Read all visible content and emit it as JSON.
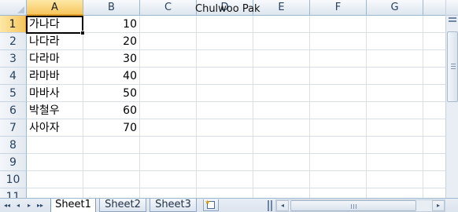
{
  "watermark": "Chulwoo Pak",
  "columns": [
    "A",
    "B",
    "C",
    "D",
    "E",
    "F",
    "G"
  ],
  "rows": [
    "1",
    "2",
    "3",
    "4",
    "5",
    "6",
    "7",
    "8",
    "9",
    "10",
    "11"
  ],
  "active_cell": "A1",
  "cells": [
    {
      "a": "가나다",
      "b": "10"
    },
    {
      "a": "나다라",
      "b": "20"
    },
    {
      "a": "다라마",
      "b": "30"
    },
    {
      "a": "라마바",
      "b": "40"
    },
    {
      "a": "마바사",
      "b": "50"
    },
    {
      "a": "박철우",
      "b": "60"
    },
    {
      "a": "사아자",
      "b": "70"
    }
  ],
  "sheet_tabs": [
    {
      "label": "Sheet1",
      "active": true
    },
    {
      "label": "Sheet2",
      "active": false
    },
    {
      "label": "Sheet3",
      "active": false
    }
  ],
  "icons": {
    "nav_first": "◂◂",
    "nav_prev": "◂",
    "nav_next": "▸",
    "nav_last": "▸▸",
    "scroll_up": "▲",
    "scroll_down": "▼",
    "scroll_left": "◂",
    "scroll_right": "▸",
    "new_sheet": "★"
  },
  "colors": {
    "header_active": "#f7c65e",
    "grid_line": "#d9dfe6",
    "header_border": "#9eb6ce"
  }
}
